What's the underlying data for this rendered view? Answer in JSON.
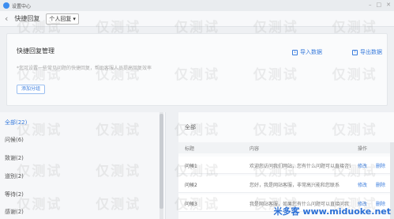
{
  "window": {
    "title": "设置中心"
  },
  "header": {
    "page_title": "快捷回复",
    "mode_select": "个人回复"
  },
  "top_panel": {
    "heading": "快捷回复管理",
    "description": "*您可设置一些常见问题的快捷回复，帮助客服人员提高回复效率",
    "add_category": "添加分组",
    "import_label": "导入数据",
    "export_label": "导出数据"
  },
  "categories": [
    {
      "label": "全部(22)",
      "active": true
    },
    {
      "label": "问候(6)"
    },
    {
      "label": "致谢(2)"
    },
    {
      "label": "道别(2)"
    },
    {
      "label": "等待(2)"
    },
    {
      "label": "感谢(2)"
    }
  ],
  "list": {
    "title": "全部",
    "columns": {
      "title": "标题",
      "content": "内容",
      "actions": "操作"
    },
    "rows": [
      {
        "title": "问候1",
        "content": "欢迎您访问我们网站，您有什么问题可以直接咨询",
        "edit": "修改",
        "delete": "删除"
      },
      {
        "title": "问候2",
        "content": "您好，我是网站客服，非常高兴能和您联系",
        "edit": "修改",
        "delete": "删除"
      },
      {
        "title": "问候3",
        "content": "我是网站客服，如果您有什么问题可以直接问我",
        "edit": "修改",
        "delete": "删除"
      }
    ]
  },
  "watermark": "仅测试",
  "footer_brand": "米多客 www.miduoke.net"
}
